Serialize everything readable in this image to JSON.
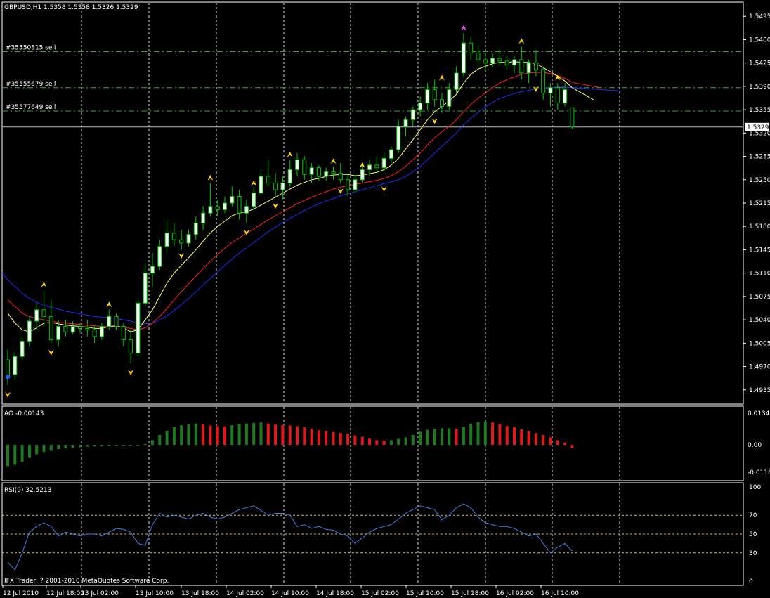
{
  "chart_data": [
    {
      "type": "candlestick",
      "symbol_header": "GBPUSD,H1  1.5358 1.5358 1.5326 1.5329",
      "current_price_label": "1.5329",
      "current_price": 1.5329,
      "ylim": [
        1.492,
        1.551
      ],
      "y_ticks": [
        "1.5495",
        "1.5460",
        "1.5425",
        "1.5390",
        "1.5355",
        "1.5320",
        "1.5285",
        "1.5250",
        "1.5215",
        "1.5180",
        "1.5145",
        "1.5110",
        "1.5075",
        "1.5040",
        "1.5005",
        "1.4970",
        "1.4935"
      ],
      "order_lines": [
        {
          "label": "#35550815 sell",
          "price": 1.5442
        },
        {
          "label": "#35555679 sell",
          "price": 1.5388
        },
        {
          "label": "#35577649 sell",
          "price": 1.5353
        }
      ],
      "colors": {
        "bull_body": "#ffffff",
        "bear_body": "#000000",
        "wick": "#00cc00",
        "ma_fast": "#ffff66",
        "ma_mid": "#ff2020",
        "ma_slow": "#1a2cff",
        "order_line": "#2fae2f",
        "fractal": "#ffd400",
        "fractal_top": "#ff40ff",
        "grid": "#ffffff"
      },
      "candles": [
        [
          1.498,
          1.4995,
          1.4942,
          1.4955
        ],
        [
          1.4958,
          1.4992,
          1.495,
          1.4985
        ],
        [
          1.4985,
          1.5015,
          1.4978,
          1.5008
        ],
        [
          1.5008,
          1.5045,
          1.5,
          1.5038
        ],
        [
          1.5038,
          1.5065,
          1.5025,
          1.5055
        ],
        [
          1.5055,
          1.5085,
          1.503,
          1.5045
        ],
        [
          1.5045,
          1.507,
          1.5005,
          1.501
        ],
        [
          1.501,
          1.504,
          1.5,
          1.503
        ],
        [
          1.503,
          1.504,
          1.5015,
          1.5022
        ],
        [
          1.5022,
          1.5038,
          1.5018,
          1.503
        ],
        [
          1.503,
          1.5035,
          1.502,
          1.5027
        ],
        [
          1.5027,
          1.504,
          1.5015,
          1.5025
        ],
        [
          1.5025,
          1.503,
          1.5005,
          1.5015
        ],
        [
          1.5015,
          1.5035,
          1.501,
          1.503
        ],
        [
          1.503,
          1.5055,
          1.5025,
          1.5045
        ],
        [
          1.5045,
          1.505,
          1.5025,
          1.503
        ],
        [
          1.503,
          1.5035,
          1.5,
          1.501
        ],
        [
          1.501,
          1.5025,
          1.4975,
          1.499
        ],
        [
          1.499,
          1.507,
          1.4985,
          1.5065
        ],
        [
          1.5065,
          1.5125,
          1.506,
          1.511
        ],
        [
          1.511,
          1.514,
          1.509,
          1.512
        ],
        [
          1.512,
          1.516,
          1.5115,
          1.515
        ],
        [
          1.515,
          1.519,
          1.514,
          1.517
        ],
        [
          1.517,
          1.5185,
          1.515,
          1.516
        ],
        [
          1.516,
          1.5175,
          1.5145,
          1.5155
        ],
        [
          1.5155,
          1.5175,
          1.515,
          1.5168
        ],
        [
          1.5168,
          1.5195,
          1.516,
          1.5185
        ],
        [
          1.5185,
          1.521,
          1.5175,
          1.52
        ],
        [
          1.52,
          1.5245,
          1.5195,
          1.521
        ],
        [
          1.521,
          1.522,
          1.5195,
          1.5205
        ],
        [
          1.5205,
          1.5225,
          1.52,
          1.5215
        ],
        [
          1.5215,
          1.524,
          1.521,
          1.5225
        ],
        [
          1.5225,
          1.5235,
          1.519,
          1.52
        ],
        [
          1.52,
          1.522,
          1.5185,
          1.521
        ],
        [
          1.521,
          1.524,
          1.5205,
          1.523
        ],
        [
          1.523,
          1.5265,
          1.5225,
          1.5255
        ],
        [
          1.5255,
          1.528,
          1.524,
          1.5245
        ],
        [
          1.5245,
          1.526,
          1.5225,
          1.5235
        ],
        [
          1.5235,
          1.5255,
          1.522,
          1.5245
        ],
        [
          1.5245,
          1.528,
          1.524,
          1.5265
        ],
        [
          1.5265,
          1.529,
          1.5255,
          1.528
        ],
        [
          1.528,
          1.5285,
          1.525,
          1.5258
        ],
        [
          1.5258,
          1.5275,
          1.5245,
          1.5268
        ],
        [
          1.5268,
          1.5272,
          1.5248,
          1.5255
        ],
        [
          1.5255,
          1.5268,
          1.5248,
          1.5262
        ],
        [
          1.5262,
          1.527,
          1.525,
          1.526
        ],
        [
          1.526,
          1.5275,
          1.5245,
          1.525
        ],
        [
          1.525,
          1.526,
          1.5225,
          1.5235
        ],
        [
          1.5235,
          1.5258,
          1.523,
          1.525
        ],
        [
          1.525,
          1.5272,
          1.5245,
          1.5265
        ],
        [
          1.5265,
          1.528,
          1.5255,
          1.5272
        ],
        [
          1.5272,
          1.5285,
          1.526,
          1.5268
        ],
        [
          1.5268,
          1.529,
          1.5262,
          1.5282
        ],
        [
          1.5282,
          1.53,
          1.5275,
          1.5295
        ],
        [
          1.5295,
          1.534,
          1.529,
          1.533
        ],
        [
          1.533,
          1.5345,
          1.5315,
          1.534
        ],
        [
          1.534,
          1.536,
          1.533,
          1.5355
        ],
        [
          1.5355,
          1.5375,
          1.5345,
          1.5365
        ],
        [
          1.5365,
          1.5395,
          1.5355,
          1.5385
        ],
        [
          1.5385,
          1.54,
          1.536,
          1.537
        ],
        [
          1.537,
          1.538,
          1.535,
          1.536
        ],
        [
          1.536,
          1.5395,
          1.5355,
          1.5385
        ],
        [
          1.5385,
          1.542,
          1.538,
          1.541
        ],
        [
          1.541,
          1.547,
          1.5405,
          1.5455
        ],
        [
          1.5455,
          1.5465,
          1.543,
          1.544
        ],
        [
          1.544,
          1.5455,
          1.542,
          1.543
        ],
        [
          1.543,
          1.544,
          1.5415,
          1.5425
        ],
        [
          1.5425,
          1.544,
          1.5418,
          1.5432
        ],
        [
          1.5432,
          1.5445,
          1.542,
          1.5428
        ],
        [
          1.5428,
          1.5435,
          1.5415,
          1.5422
        ],
        [
          1.5422,
          1.5435,
          1.541,
          1.543
        ],
        [
          1.543,
          1.545,
          1.54,
          1.541
        ],
        [
          1.541,
          1.543,
          1.5395,
          1.5425
        ],
        [
          1.5425,
          1.5445,
          1.5405,
          1.5415
        ],
        [
          1.5415,
          1.542,
          1.537,
          1.538
        ],
        [
          1.538,
          1.5395,
          1.536,
          1.5388
        ],
        [
          1.5388,
          1.5395,
          1.5355,
          1.5365
        ],
        [
          1.5365,
          1.5395,
          1.536,
          1.5385
        ],
        [
          1.5358,
          1.5358,
          1.5326,
          1.5329
        ]
      ],
      "ma_fast": [
        1.505,
        1.5035,
        1.5025,
        1.5022,
        1.5028,
        1.5035,
        1.5036,
        1.5034,
        1.5032,
        1.5031,
        1.503,
        1.5029,
        1.5027,
        1.5027,
        1.503,
        1.5031,
        1.5028,
        1.5022,
        1.5025,
        1.504,
        1.5055,
        1.5075,
        1.5095,
        1.511,
        1.5122,
        1.5133,
        1.5145,
        1.5158,
        1.517,
        1.518,
        1.5188,
        1.5196,
        1.52,
        1.5202,
        1.5206,
        1.5212,
        1.5218,
        1.5224,
        1.523,
        1.5236,
        1.5242,
        1.5246,
        1.525,
        1.5252,
        1.5255,
        1.5257,
        1.5258,
        1.5258,
        1.5256,
        1.5257,
        1.5259,
        1.5261,
        1.5265,
        1.5272,
        1.5282,
        1.5296,
        1.531,
        1.5325,
        1.534,
        1.5352,
        1.536,
        1.5368,
        1.5378,
        1.5395,
        1.5408,
        1.5416,
        1.542,
        1.5424,
        1.5426,
        1.5426,
        1.5427,
        1.5426,
        1.5426,
        1.5424,
        1.5418,
        1.5412,
        1.5405,
        1.5398,
        1.5388
      ],
      "ma_mid": [
        1.507,
        1.506,
        1.505,
        1.5045,
        1.5042,
        1.504,
        1.5038,
        1.5036,
        1.5035,
        1.5034,
        1.5033,
        1.5032,
        1.5031,
        1.503,
        1.503,
        1.503,
        1.5029,
        1.5027,
        1.5025,
        1.5028,
        1.5035,
        1.5045,
        1.5057,
        1.507,
        1.5082,
        1.5094,
        1.5105,
        1.5117,
        1.5128,
        1.5138,
        1.5147,
        1.5156,
        1.5163,
        1.517,
        1.5176,
        1.5183,
        1.519,
        1.5196,
        1.5202,
        1.5208,
        1.5214,
        1.5219,
        1.5224,
        1.5228,
        1.5232,
        1.5236,
        1.5239,
        1.5241,
        1.5243,
        1.5245,
        1.5247,
        1.5249,
        1.5252,
        1.5256,
        1.5262,
        1.527,
        1.528,
        1.529,
        1.5302,
        1.5313,
        1.5322,
        1.533,
        1.534,
        1.5352,
        1.5363,
        1.5372,
        1.538,
        1.5388,
        1.5395,
        1.54,
        1.5404,
        1.5408,
        1.541,
        1.5411,
        1.5411,
        1.5409,
        1.5406,
        1.5402,
        1.5396
      ],
      "ma_slow": [
        1.51,
        1.509,
        1.508,
        1.5072,
        1.5066,
        1.5062,
        1.5059,
        1.5056,
        1.5053,
        1.5051,
        1.5049,
        1.5047,
        1.5045,
        1.5044,
        1.5043,
        1.5042,
        1.504,
        1.5038,
        1.5035,
        1.5034,
        1.5035,
        1.504,
        1.5046,
        1.5054,
        1.5063,
        1.5072,
        1.5082,
        1.5092,
        1.5102,
        1.5112,
        1.5122,
        1.5131,
        1.514,
        1.5148,
        1.5156,
        1.5164,
        1.5172,
        1.5179,
        1.5186,
        1.5192,
        1.5198,
        1.5204,
        1.5209,
        1.5214,
        1.5218,
        1.5222,
        1.5226,
        1.5229,
        1.5232,
        1.5235,
        1.5238,
        1.5241,
        1.5244,
        1.5247,
        1.525,
        1.5255,
        1.5262,
        1.527,
        1.528,
        1.529,
        1.53,
        1.531,
        1.532,
        1.5332,
        1.5342,
        1.5351,
        1.5359,
        1.5366,
        1.5372,
        1.5376,
        1.5379,
        1.5382,
        1.5384,
        1.5386,
        1.5387,
        1.5388,
        1.5389,
        1.5389,
        1.5388
      ],
      "fractals_up": [
        [
          5,
          1.5093
        ],
        [
          14,
          1.5063
        ],
        [
          28,
          1.5253
        ],
        [
          34,
          1.5245
        ],
        [
          39,
          1.5288
        ],
        [
          45,
          1.5278
        ],
        [
          49,
          1.5272
        ],
        [
          60,
          1.5403
        ],
        [
          63,
          1.5478
        ],
        [
          71,
          1.5458
        ],
        [
          76,
          1.5403
        ]
      ],
      "fractals_down": [
        [
          0,
          1.4932
        ],
        [
          6,
          1.4995
        ],
        [
          17,
          1.4965
        ],
        [
          24,
          1.514
        ],
        [
          33,
          1.5175
        ],
        [
          37,
          1.5215
        ],
        [
          46,
          1.5237
        ],
        [
          52,
          1.524
        ],
        [
          59,
          1.5342
        ],
        [
          73,
          1.539
        ]
      ]
    },
    {
      "type": "bar",
      "label": "AO -0.00143",
      "ylim": [
        -0.01161,
        0.01343
      ],
      "y_ticks": [
        "0.01343",
        "0.00",
        "-0.01161"
      ],
      "colors": {
        "up": "#1f7a1f",
        "down": "#e01a1a"
      },
      "values": [
        -0.009,
        -0.0085,
        -0.0072,
        -0.0055,
        -0.004,
        -0.003,
        -0.0025,
        -0.0018,
        -0.0015,
        -0.0012,
        -0.001,
        -0.0008,
        -0.0007,
        -0.0006,
        -0.0004,
        -0.0003,
        -0.0002,
        -0.0001,
        -0.0001,
        0.0004,
        0.002,
        0.0042,
        0.006,
        0.0075,
        0.0083,
        0.0088,
        0.009,
        0.0088,
        0.0082,
        0.008,
        0.0078,
        0.0083,
        0.0088,
        0.009,
        0.0093,
        0.0095,
        0.009,
        0.0086,
        0.0084,
        0.0082,
        0.0079,
        0.0074,
        0.0068,
        0.0062,
        0.0058,
        0.0054,
        0.005,
        0.0046,
        0.004,
        0.0034,
        0.0026,
        0.002,
        0.0018,
        0.002,
        0.0025,
        0.0032,
        0.0042,
        0.0056,
        0.0064,
        0.0068,
        0.007,
        0.007,
        0.0068,
        0.0078,
        0.009,
        0.0096,
        0.01,
        0.0095,
        0.0088,
        0.008,
        0.0074,
        0.0066,
        0.0058,
        0.005,
        0.0042,
        0.0032,
        0.002,
        0.001,
        -0.0014
      ]
    },
    {
      "type": "line",
      "label": "RSI(9) 32.5213",
      "ylim": [
        0,
        100
      ],
      "y_ticks": [
        100,
        70,
        50,
        30,
        0
      ],
      "levels": [
        70,
        50,
        30
      ],
      "colors": {
        "line": "#3f7fe0",
        "level": "#d8c04a"
      },
      "values": [
        20,
        12,
        30,
        52,
        58,
        62,
        58,
        48,
        52,
        50,
        48,
        50,
        50,
        48,
        52,
        56,
        55,
        52,
        40,
        38,
        60,
        72,
        68,
        70,
        68,
        66,
        70,
        72,
        68,
        66,
        68,
        72,
        76,
        78,
        80,
        75,
        70,
        72,
        72,
        70,
        58,
        60,
        56,
        58,
        55,
        54,
        50,
        48,
        40,
        46,
        52,
        56,
        58,
        60,
        66,
        72,
        76,
        80,
        78,
        76,
        65,
        70,
        78,
        82,
        78,
        68,
        62,
        60,
        58,
        58,
        56,
        52,
        48,
        50,
        40,
        30,
        36,
        40,
        32
      ]
    }
  ],
  "x_labels": [
    "12 Jul 2010",
    "12 Jul 18:00",
    "13 Jul 02:00",
    "13 Jul 10:00",
    "13 Jul 18:00",
    "14 Jul 02:00",
    "14 Jul 10:00",
    "14 Jul 18:00",
    "15 Jul 02:00",
    "15 Jul 10:00",
    "15 Jul 18:00",
    "16 Jul 02:00",
    "16 Jul 10:00"
  ],
  "footer_text": "IFX Trader, ? 2001-2010 MetaQuotes Software Corp."
}
